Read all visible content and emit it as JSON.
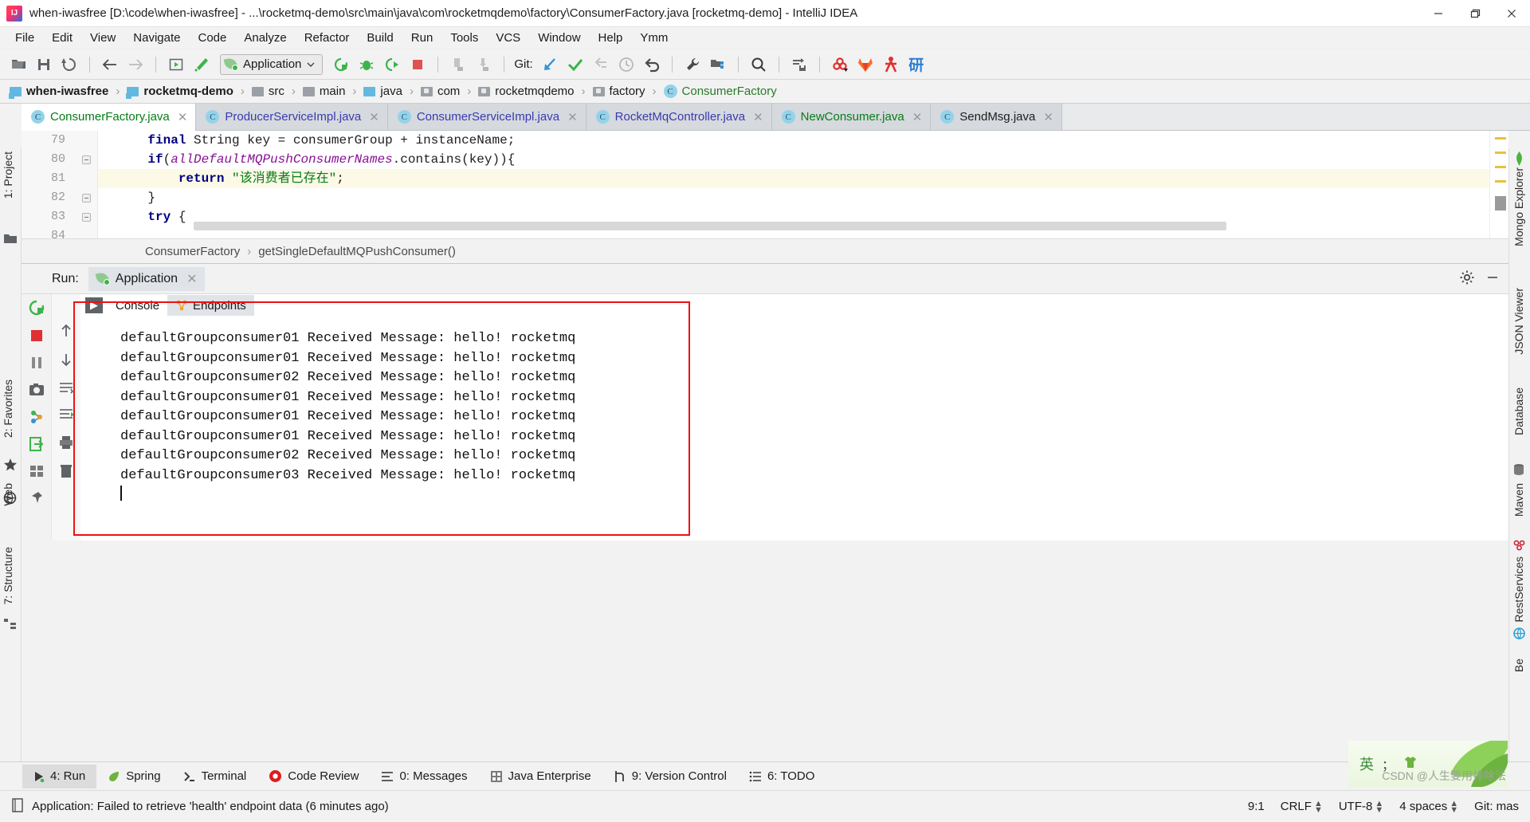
{
  "window": {
    "title": "when-iwasfree [D:\\code\\when-iwasfree] - ...\\rocketmq-demo\\src\\main\\java\\com\\rocketmqdemo\\factory\\ConsumerFactory.java [rocketmq-demo] - IntelliJ IDEA",
    "minimize": "minimize-icon",
    "maximize": "restore-icon",
    "close": "close-icon"
  },
  "menu": [
    {
      "label": "File"
    },
    {
      "label": "Edit"
    },
    {
      "label": "View"
    },
    {
      "label": "Navigate"
    },
    {
      "label": "Code"
    },
    {
      "label": "Analyze"
    },
    {
      "label": "Refactor"
    },
    {
      "label": "Build"
    },
    {
      "label": "Run"
    },
    {
      "label": "Tools"
    },
    {
      "label": "VCS"
    },
    {
      "label": "Window"
    },
    {
      "label": "Help"
    },
    {
      "label": "Ymm"
    }
  ],
  "toolbar": {
    "run_config": "Application",
    "git_label": "Git:",
    "icons": [
      "open-folder-icon",
      "save-all-icon",
      "sync-icon",
      "back-arrow-icon",
      "forward-arrow-icon",
      "run-console-icon",
      "build-hammer-icon",
      "run-icon",
      "debug-icon",
      "run-coverage-icon",
      "stop-icon",
      "profiler-icon",
      "download-icon",
      "update-project-icon",
      "commit-icon",
      "push-icon",
      "history-icon",
      "rollback-icon",
      "settings-wrench-icon",
      "project-structure-icon",
      "search-everywhere-icon",
      "database-sync-icon",
      "maven-icon",
      "gitlab-icon",
      "person-icon",
      "yan-icon"
    ]
  },
  "breadcrumb": [
    {
      "label": "when-iwasfree",
      "icon": "module-folder-icon",
      "bold": true
    },
    {
      "label": "rocketmq-demo",
      "icon": "module-folder-icon",
      "bold": true
    },
    {
      "label": "src",
      "icon": "folder-icon",
      "bold": false
    },
    {
      "label": "main",
      "icon": "folder-icon",
      "bold": false
    },
    {
      "label": "java",
      "icon": "source-folder-icon",
      "bold": false
    },
    {
      "label": "com",
      "icon": "package-icon",
      "bold": false
    },
    {
      "label": "rocketmqdemo",
      "icon": "package-icon",
      "bold": false
    },
    {
      "label": "factory",
      "icon": "package-icon",
      "bold": false
    },
    {
      "label": "ConsumerFactory",
      "icon": "class-icon",
      "bold": false
    }
  ],
  "editor_tabs": [
    {
      "label": "ConsumerFactory.java",
      "active": true,
      "color": "#067d17"
    },
    {
      "label": "ProducerServiceImpl.java",
      "active": false,
      "color": "#3a3ab0"
    },
    {
      "label": "ConsumerServiceImpl.java",
      "active": false,
      "color": "#3a3ab0"
    },
    {
      "label": "RocketMqController.java",
      "active": false,
      "color": "#3a3ab0"
    },
    {
      "label": "NewConsumer.java",
      "active": false,
      "color": "#067d17"
    },
    {
      "label": "SendMsg.java",
      "active": false,
      "color": "#1d1d1d"
    }
  ],
  "editor": {
    "line_numbers": [
      "79",
      "80",
      "81",
      "82",
      "83",
      "84"
    ],
    "lines": [
      {
        "num": "79",
        "highlight": false,
        "tokens": [
          {
            "t": "        ",
            "c": "pl"
          },
          {
            "t": "final",
            "c": "kw"
          },
          {
            "t": " String key = consumerGroup + instanceName;",
            "c": "pl"
          }
        ]
      },
      {
        "num": "80",
        "highlight": false,
        "tokens": [
          {
            "t": "        ",
            "c": "pl"
          },
          {
            "t": "if",
            "c": "kw"
          },
          {
            "t": "(",
            "c": "pl"
          },
          {
            "t": "allDefaultMQPushConsumerNames",
            "c": "fld"
          },
          {
            "t": ".contains(key)){",
            "c": "pl"
          }
        ]
      },
      {
        "num": "81",
        "highlight": true,
        "tokens": [
          {
            "t": "            ",
            "c": "pl"
          },
          {
            "t": "return",
            "c": "kw"
          },
          {
            "t": " ",
            "c": "pl"
          },
          {
            "t": "\"该消费者已存在\"",
            "c": "str"
          },
          {
            "t": ";",
            "c": "pl"
          }
        ]
      },
      {
        "num": "82",
        "highlight": false,
        "tokens": [
          {
            "t": "        }",
            "c": "pl"
          }
        ]
      },
      {
        "num": "83",
        "highlight": false,
        "tokens": [
          {
            "t": "        ",
            "c": "pl"
          },
          {
            "t": "try",
            "c": "kw"
          },
          {
            "t": " {",
            "c": "pl"
          }
        ]
      },
      {
        "num": "84",
        "highlight": false,
        "tokens": [
          {
            "t": "",
            "c": "pl"
          }
        ]
      }
    ],
    "status_breadcrumb": [
      "ConsumerFactory",
      "getSingleDefaultMQPushConsumer()"
    ]
  },
  "run_panel": {
    "label": "Run:",
    "tab": "Application",
    "tab_close": "close-icon",
    "settings_icon": "gear-icon",
    "minimize_icon": "minimize-icon",
    "console_tabs": [
      {
        "label": "Console",
        "selected": true,
        "icon": "console-icon"
      },
      {
        "label": "Endpoints",
        "selected": false,
        "icon": "endpoints-icon"
      }
    ],
    "side_icons": [
      "rerun-icon",
      "stop-icon",
      "pause-icon",
      "camera-icon",
      "thread-dump-icon",
      "exit-icon",
      "layout-icon",
      "pin-icon"
    ],
    "side_icons2": [
      "arrow-up-icon",
      "arrow-down-icon",
      "soft-wrap-icon",
      "scroll-to-end-icon",
      "print-icon",
      "trash-icon"
    ],
    "console_output": [
      "defaultGroupconsumer01 Received Message: hello! rocketmq",
      "defaultGroupconsumer01 Received Message: hello! rocketmq",
      "defaultGroupconsumer02 Received Message: hello! rocketmq",
      "defaultGroupconsumer01 Received Message: hello! rocketmq",
      "defaultGroupconsumer01 Received Message: hello! rocketmq",
      "defaultGroupconsumer01 Received Message: hello! rocketmq",
      "defaultGroupconsumer02 Received Message: hello! rocketmq",
      "defaultGroupconsumer03 Received Message: hello! rocketmq"
    ],
    "highlight_color": "#ee1111"
  },
  "left_strip": [
    {
      "label": "1: Project",
      "icon": "project-icon"
    },
    {
      "label": "2: Favorites",
      "icon": "star-icon"
    },
    {
      "label": "Web",
      "icon": "globe-icon"
    },
    {
      "label": "7: Structure",
      "icon": "structure-icon"
    }
  ],
  "right_strip": [
    {
      "label": "Mongo Explorer",
      "icon": "mongo-icon"
    },
    {
      "label": "JSON Viewer",
      "icon": "json-icon"
    },
    {
      "label": "Database",
      "icon": "database-icon"
    },
    {
      "label": "Maven",
      "icon": "maven-icon"
    },
    {
      "label": "RestServices",
      "icon": "rest-icon"
    },
    {
      "label": "Be",
      "icon": "bean-icon"
    }
  ],
  "bottom_tools": [
    {
      "label": "4: Run",
      "icon": "run-icon",
      "selected": true
    },
    {
      "label": "Spring",
      "icon": "spring-leaf-icon",
      "selected": false
    },
    {
      "label": "Terminal",
      "icon": "terminal-icon",
      "selected": false
    },
    {
      "label": "Code Review",
      "icon": "code-review-icon",
      "selected": false
    },
    {
      "label": "0: Messages",
      "icon": "messages-icon",
      "selected": false
    },
    {
      "label": "Java Enterprise",
      "icon": "java-enterprise-icon",
      "selected": false
    },
    {
      "label": "9: Version Control",
      "icon": "version-control-icon",
      "selected": false
    },
    {
      "label": "6: TODO",
      "icon": "todo-icon",
      "selected": false
    }
  ],
  "statusbar": {
    "icon": "event-log-icon",
    "message": "Application: Failed to retrieve 'health' endpoint data (6 minutes ago)",
    "caret": "9:1",
    "line_sep": "CRLF",
    "encoding": "UTF-8",
    "indent": "4 spaces",
    "git_branch": "Git: mas"
  },
  "watermark": {
    "ime": "英",
    "sep": "；",
    "credit": "CSDN @人生要用排除法"
  },
  "colors": {
    "accent_green": "#3cb44a",
    "keyword": "#000080",
    "string": "#067d17",
    "field": "#871094",
    "red": "#ee1111",
    "tab_bg": "#d6d9dd"
  }
}
